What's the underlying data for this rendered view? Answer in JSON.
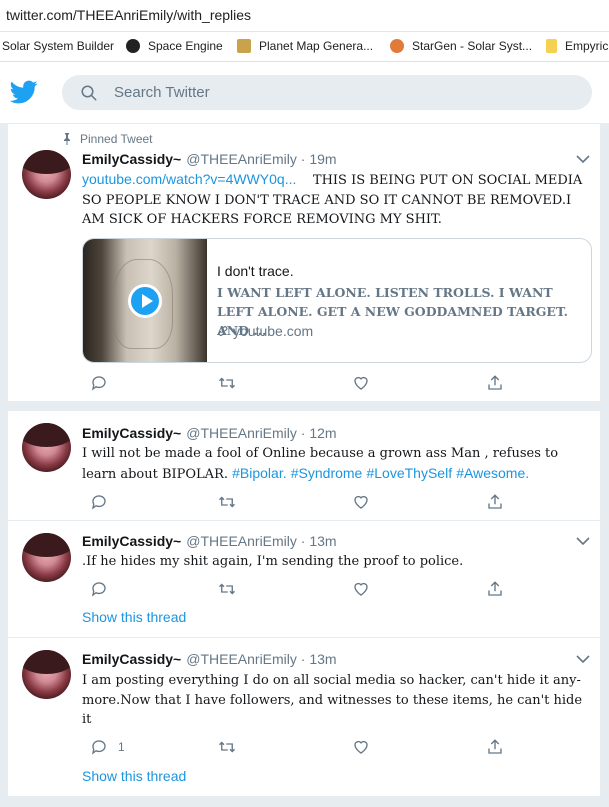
{
  "browser": {
    "url": "twitter.com/THEEAnriEmily/with_replies",
    "bookmarks": [
      {
        "label": "Solar System Builder",
        "icon": "solar-system-builder-icon",
        "color": "#ffffff"
      },
      {
        "label": "Space Engine",
        "icon": "space-engine-icon",
        "color": "#222222"
      },
      {
        "label": "Planet Map Genera...",
        "icon": "planet-map-icon",
        "color": "#c9a24b"
      },
      {
        "label": "StarGen - Solar Syst...",
        "icon": "stargen-icon",
        "color": "#e07b3a"
      },
      {
        "label": "Empyric",
        "icon": "bookmark-page-icon",
        "color": "#f4d24f"
      }
    ]
  },
  "twitter": {
    "search_placeholder": "Search Twitter",
    "brand_color": "#1da1f2"
  },
  "tweets": [
    {
      "pinned_label": "Pinned Tweet",
      "name": "EmilyCassidy~",
      "handle": "@THEEAnriEmily",
      "time": "19m",
      "link_text": "youtube.com/watch?v=4WWY0q...",
      "text": "THIS IS BEING PUT ON SOCIAL MEDIA SO PEOPLE KNOW I DON'T TRACE AND SO IT CANNOT BE REMOVED.I AM SICK OF HACKERS FORCE REMOVING MY SHIT.",
      "card": {
        "title": "I don't trace.",
        "description": "I WANT LEFT ALONE. LISTEN TROLLS. I WANT LEFT ALONE. GET A NEW GODDAMNED TARGET. AND ...",
        "domain": "youtube.com"
      }
    },
    {
      "name": "EmilyCassidy~",
      "handle": "@THEEAnriEmily",
      "time": "12m",
      "text": "I will not be  made a  fool of Online because a grown ass Man , refuses to learn about BIPOLAR.",
      "hashtags": [
        "#Bipolar.",
        "#Syndrome",
        "#LoveThySelf",
        "#Awesome."
      ]
    },
    {
      "name": "EmilyCassidy~",
      "handle": "@THEEAnriEmily",
      "time": "13m",
      "text": ".If he hides my shit again, I'm sending the proof to police.",
      "thread_label": "Show this thread"
    },
    {
      "name": "EmilyCassidy~",
      "handle": "@THEEAnriEmily",
      "time": "13m",
      "text": "I am posting everything I do on all social media so hacker, can't hide it any-more.Now that I have followers, and witnesses to these items, he can't hide it",
      "reply_count": "1",
      "thread_label": "Show this thread"
    }
  ]
}
